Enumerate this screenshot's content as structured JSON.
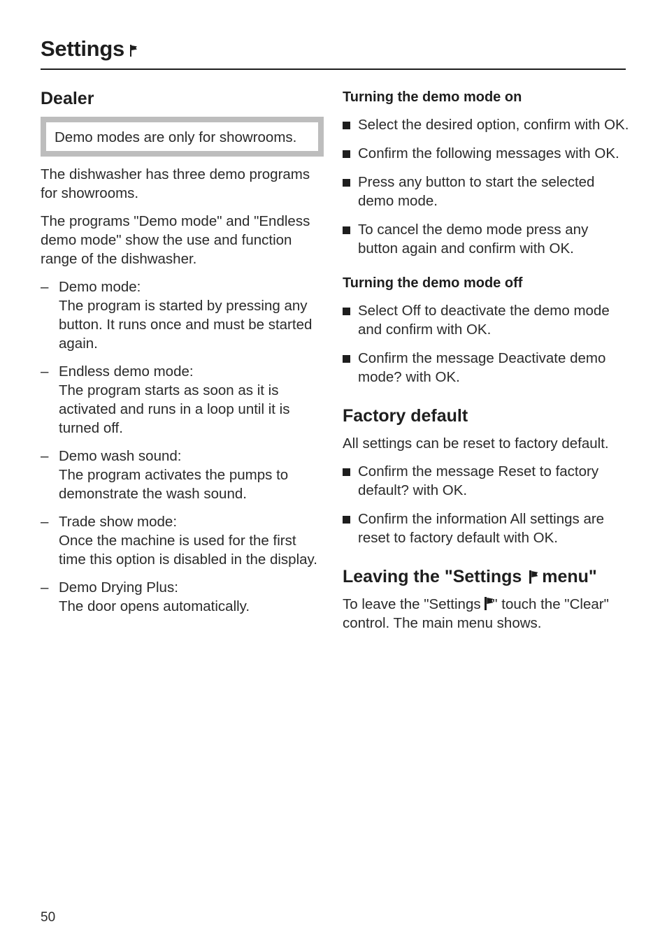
{
  "header": {
    "title": "Settings",
    "title_icon": "flag-icon"
  },
  "left": {
    "heading": "Dealer",
    "note": "Demo modes are  only for showrooms.",
    "paragraphs": [
      "The dishwasher has three demo programs for showrooms.",
      "The programs \"Demo mode\" and \"Endless demo mode\" show the use and function range of the dishwasher."
    ],
    "items": [
      {
        "title": "Demo mode:",
        "text": "The program is started by pressing any button. It runs once and must be started again."
      },
      {
        "title": "Endless demo mode:",
        "text": "The program starts as soon as it is activated and runs in a loop until it is turned off."
      },
      {
        "title": "Demo wash sound:",
        "text": "The program activates the pumps to demonstrate the wash sound."
      },
      {
        "title": "Trade show mode:",
        "text": "Once the machine is used for the first time this option is disabled in the display."
      },
      {
        "title": "Demo Drying Plus:",
        "text": "The door opens automatically."
      }
    ]
  },
  "right": {
    "demo_on": {
      "heading": "Turning the demo mode on",
      "steps": [
        "Select the desired option, confirm with OK.",
        "Confirm the following messages with OK.",
        "Press any button to start the selected demo mode.",
        "To cancel the demo mode press any button again and confirm with OK."
      ]
    },
    "demo_off": {
      "heading": "Turning the demo mode off",
      "steps": [
        "Select Off to deactivate the demo mode and confirm with OK.",
        "Confirm the message Deactivate demo mode? with OK."
      ]
    },
    "factory": {
      "heading": "Factory default",
      "intro": "All settings can be reset to factory default.",
      "steps": [
        "Confirm the message Reset to factory default? with OK.",
        "Confirm the information All settings are reset to factory default with OK."
      ]
    },
    "leaving": {
      "heading_before": "Leaving the \"Settings ",
      "heading_after": " menu\"",
      "text_before": "To leave the \"Settings ",
      "text_after": "\" touch the \"Clear\" control. The main menu shows."
    }
  },
  "footer": {
    "page_number": "50"
  }
}
